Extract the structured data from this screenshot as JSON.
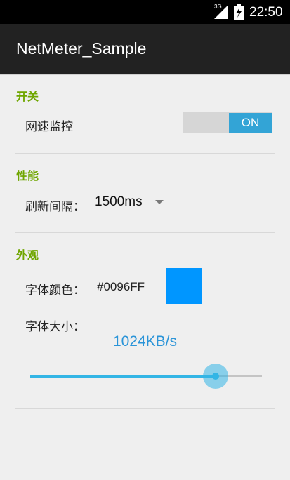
{
  "status_bar": {
    "network": "3G",
    "time": "22:50"
  },
  "app_title": "NetMeter_Sample",
  "sections": {
    "switch": {
      "header": "开关",
      "label": "网速监控",
      "toggle_text": "ON"
    },
    "performance": {
      "header": "性能",
      "label": "刷新间隔：",
      "value": "1500ms"
    },
    "appearance": {
      "header": "外观",
      "color_label": "字体颜色：",
      "color_value": "#0096FF",
      "size_label": "字体大小：",
      "preview_text": "1024KB/s",
      "slider_fraction": 0.8
    }
  },
  "colors": {
    "accent": "#33b5e5",
    "header_green": "#6fa600",
    "font_color": "#0096FF",
    "preview_text": "#2a94d8"
  }
}
